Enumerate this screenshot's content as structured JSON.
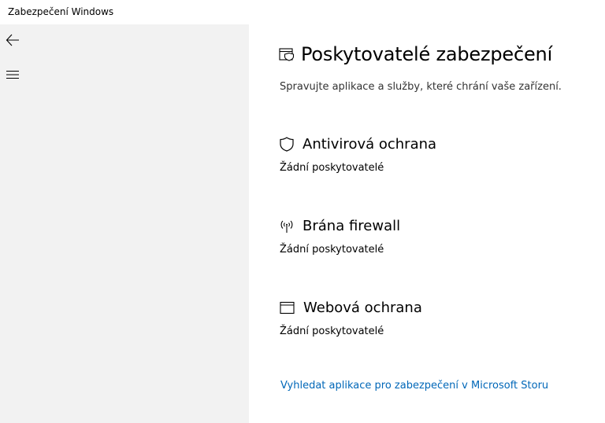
{
  "window": {
    "title": "Zabezpečení Windows"
  },
  "sidebar": {
    "back_icon": "arrow-left-icon",
    "menu_icon": "hamburger-menu-icon"
  },
  "main": {
    "title_icon": "shield-in-window-icon",
    "title": "Poskytovatelé zabezpečení",
    "subtitle": "Spravujte aplikace a služby, které chrání vaše zařízení.",
    "sections": [
      {
        "icon": "shield-icon",
        "title": "Antivirová ochrana",
        "status": "Žádní poskytovatelé"
      },
      {
        "icon": "firewall-antenna-icon",
        "title": "Brána firewall",
        "status": "Žádní poskytovatelé"
      },
      {
        "icon": "browser-window-icon",
        "title": "Webová ochrana",
        "status": "Žádní poskytovatelé"
      }
    ],
    "store_link": "Vyhledat aplikace pro zabezpečení v Microsoft Storu"
  },
  "colors": {
    "sidebar_bg": "#f2f2f2",
    "link": "#0067b8",
    "text": "#000000"
  }
}
